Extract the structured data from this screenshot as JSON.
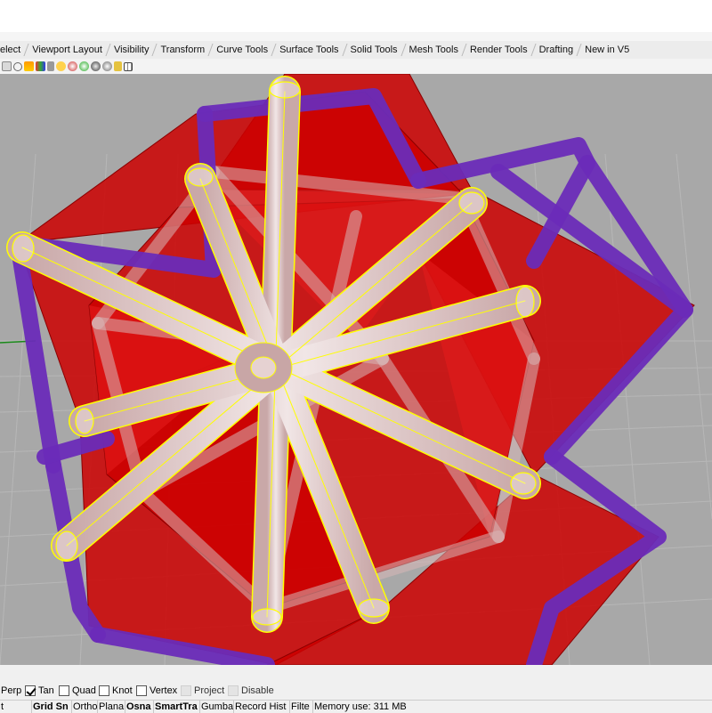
{
  "tabs": [
    {
      "label": "elect"
    },
    {
      "label": "Viewport Layout"
    },
    {
      "label": "Visibility"
    },
    {
      "label": "Transform"
    },
    {
      "label": "Curve Tools"
    },
    {
      "label": "Surface Tools"
    },
    {
      "label": "Solid Tools"
    },
    {
      "label": "Mesh Tools"
    },
    {
      "label": "Render Tools"
    },
    {
      "label": "Drafting"
    },
    {
      "label": "New in V5"
    }
  ],
  "toolbar_icons": [
    "select-icon",
    "zoom-icon",
    "render-icon",
    "color-icon",
    "lock-icon",
    "light-icon",
    "shade-icon",
    "sphere-icon",
    "material-icon",
    "wand-icon",
    "cursor-icon",
    "grid-snap-icon"
  ],
  "osnaps": [
    {
      "label": "Perp",
      "checked": false,
      "disabled": false,
      "show_box": false
    },
    {
      "label": "Tan",
      "checked": true,
      "disabled": false,
      "show_box": true
    },
    {
      "label": "Quad",
      "checked": false,
      "disabled": false,
      "show_box": true
    },
    {
      "label": "Knot",
      "checked": false,
      "disabled": false,
      "show_box": true
    },
    {
      "label": "Vertex",
      "checked": false,
      "disabled": false,
      "show_box": true
    },
    {
      "label": "Project",
      "checked": false,
      "disabled": true,
      "show_box": true
    },
    {
      "label": "Disable",
      "checked": false,
      "disabled": true,
      "show_box": true
    }
  ],
  "status": [
    {
      "label": "t",
      "bold": false
    },
    {
      "label": "Grid Sn",
      "bold": true
    },
    {
      "label": "Ortho",
      "bold": false
    },
    {
      "label": "Plana",
      "bold": false
    },
    {
      "label": "Osna",
      "bold": true
    },
    {
      "label": "SmartTra",
      "bold": true
    },
    {
      "label": "Gumba",
      "bold": false
    },
    {
      "label": "Record Hist",
      "bold": false
    },
    {
      "label": "Filte",
      "bold": false
    },
    {
      "label": "Memory use: 311 MB",
      "bold": false
    }
  ],
  "colors": {
    "viewport_bg": "#a8a8a8",
    "grid": "#b9b9b9",
    "red_fill": "#cc0000",
    "purple_frame": "#6a2bb8",
    "rod": "#e7d7d7",
    "selection": "#ffff00",
    "axis_green": "#1a8a1a"
  }
}
